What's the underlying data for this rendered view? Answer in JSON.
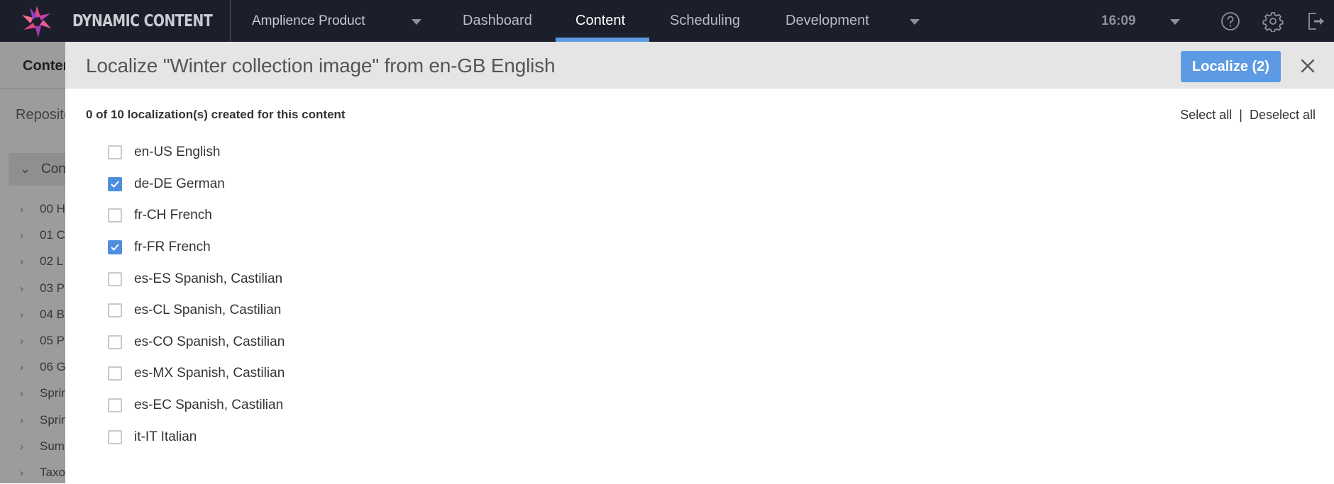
{
  "topbar": {
    "brand": "DYNAMIC CONTENT",
    "hub": "Amplience Product",
    "nav": [
      {
        "label": "Dashboard",
        "active": false
      },
      {
        "label": "Content",
        "active": true
      },
      {
        "label": "Scheduling",
        "active": false
      },
      {
        "label": "Development",
        "active": false
      }
    ],
    "time": "16:09",
    "icons": [
      "help-icon",
      "gear-icon",
      "logout-icon"
    ],
    "accent_color": "#5d9be3"
  },
  "background": {
    "title": "Content",
    "repository_label": "Repositories",
    "tree_root": "Content",
    "tree_items": [
      "00 H",
      "01 C",
      "02 L",
      "03 P",
      "04 B",
      "05 P",
      "06 G",
      "Sprin",
      "Sprin",
      "Sum",
      "Taxo"
    ]
  },
  "modal": {
    "title": "Localize \"Winter collection image\" from en-GB English",
    "localize_button": "Localize (2)",
    "count_text": "0 of 10 localization(s) created for this content",
    "select_all": "Select all",
    "separator": "|",
    "deselect_all": "Deselect all",
    "locales": [
      {
        "label": "en-US English",
        "checked": false
      },
      {
        "label": "de-DE German",
        "checked": true
      },
      {
        "label": "fr-CH French",
        "checked": false
      },
      {
        "label": "fr-FR French",
        "checked": true
      },
      {
        "label": "es-ES Spanish, Castilian",
        "checked": false
      },
      {
        "label": "es-CL Spanish, Castilian",
        "checked": false
      },
      {
        "label": "es-CO Spanish, Castilian",
        "checked": false
      },
      {
        "label": "es-MX Spanish, Castilian",
        "checked": false
      },
      {
        "label": "es-EC Spanish, Castilian",
        "checked": false
      },
      {
        "label": "it-IT Italian",
        "checked": false
      }
    ],
    "button_color": "#5c9be3",
    "checkbox_color": "#4d8fde"
  }
}
